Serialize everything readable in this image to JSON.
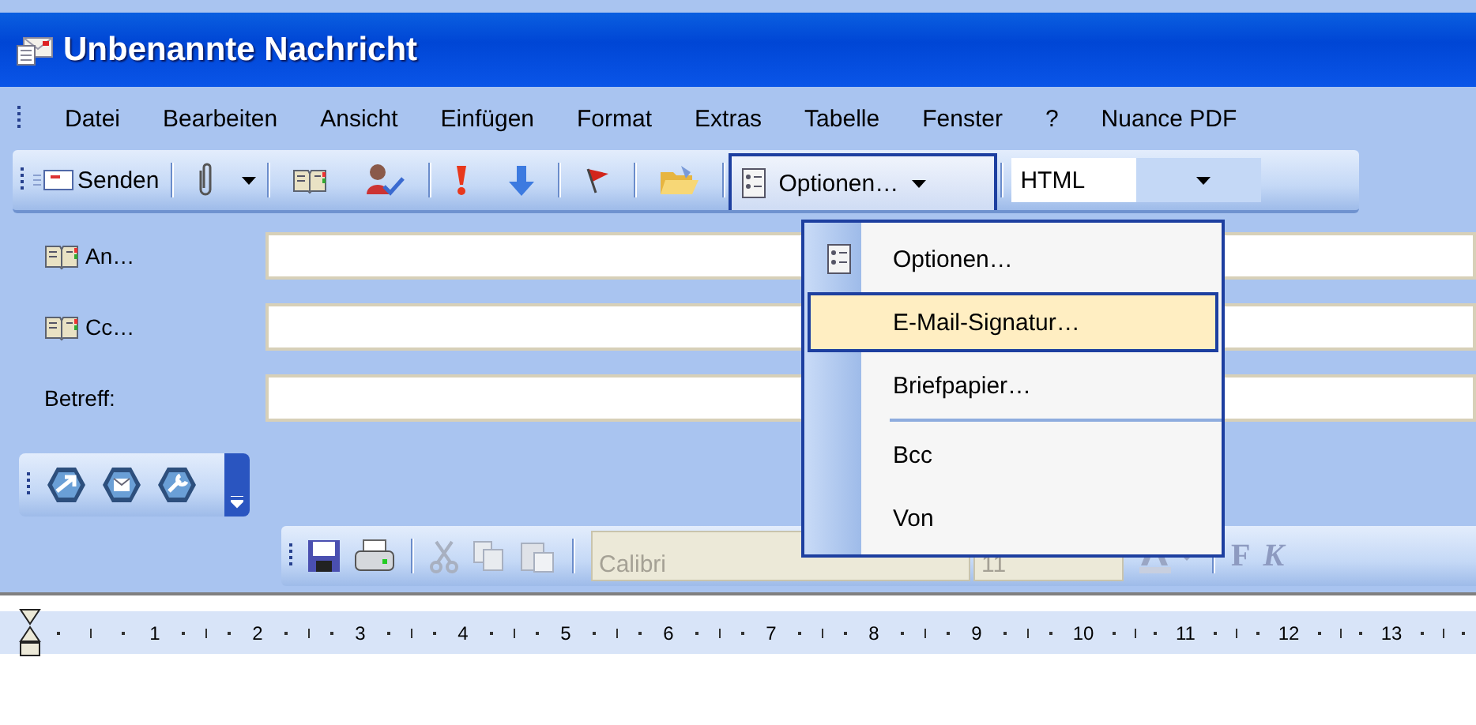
{
  "window": {
    "title": "Unbenannte Nachricht"
  },
  "menubar": [
    {
      "label": "Datei"
    },
    {
      "label": "Bearbeiten"
    },
    {
      "label": "Ansicht"
    },
    {
      "label": "Einfügen"
    },
    {
      "label": "Format"
    },
    {
      "label": "Extras"
    },
    {
      "label": "Tabelle"
    },
    {
      "label": "Fenster"
    },
    {
      "label": "?"
    },
    {
      "label": "Nuance PDF"
    }
  ],
  "toolbar": {
    "send": "Senden",
    "options": "Optionen…",
    "message_format": "HTML"
  },
  "fields": [
    {
      "label": "An…",
      "kind": "address"
    },
    {
      "label": "Cc…",
      "kind": "address"
    },
    {
      "label": "Betreff:",
      "kind": "plain"
    }
  ],
  "format_toolbar": {
    "font": "Calibri",
    "size": "11",
    "bold": "F",
    "italic": "K"
  },
  "options_menu": [
    {
      "kind": "command",
      "label": "Optionen…",
      "icon": true,
      "selected": false
    },
    {
      "kind": "command",
      "label": "E-Mail-Signatur…",
      "icon": false,
      "selected": true
    },
    {
      "kind": "command",
      "label": "Briefpapier…",
      "icon": false,
      "selected": false
    },
    {
      "kind": "separator"
    },
    {
      "kind": "command",
      "label": "Bcc",
      "icon": false,
      "selected": false
    },
    {
      "kind": "command",
      "label": "Von",
      "icon": false,
      "selected": false
    }
  ],
  "ruler": {
    "numbers": [
      "1",
      "2",
      "3",
      "4",
      "5",
      "6",
      "7",
      "8",
      "9",
      "10",
      "11",
      "12",
      "13"
    ]
  }
}
